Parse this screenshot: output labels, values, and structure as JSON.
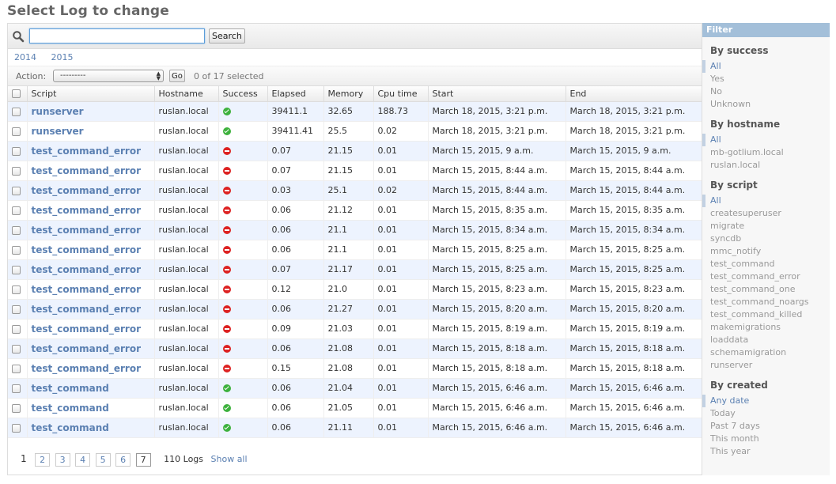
{
  "page": {
    "title": "Select Log to change"
  },
  "search": {
    "value": "",
    "button_label": "Search"
  },
  "date_hierarchy": [
    "2014",
    "2015"
  ],
  "actions": {
    "label": "Action:",
    "selected": "---------",
    "go_label": "Go",
    "selection_count": "0 of 17 selected"
  },
  "table": {
    "headers": [
      "Script",
      "Hostname",
      "Success",
      "Elapsed",
      "Memory",
      "Cpu time",
      "Start",
      "End"
    ],
    "rows": [
      {
        "script": "runserver",
        "hostname": "ruslan.local",
        "success": "ok",
        "elapsed": "39411.1",
        "memory": "32.65",
        "cpu": "188.73",
        "start": "March 18, 2015, 3:21 p.m.",
        "end": "March 18, 2015, 3:21 p.m."
      },
      {
        "script": "runserver",
        "hostname": "ruslan.local",
        "success": "ok",
        "elapsed": "39411.41",
        "memory": "25.5",
        "cpu": "0.02",
        "start": "March 18, 2015, 3:21 p.m.",
        "end": "March 18, 2015, 3:21 p.m."
      },
      {
        "script": "test_command_error",
        "hostname": "ruslan.local",
        "success": "err",
        "elapsed": "0.07",
        "memory": "21.15",
        "cpu": "0.01",
        "start": "March 15, 2015, 9 a.m.",
        "end": "March 15, 2015, 9 a.m."
      },
      {
        "script": "test_command_error",
        "hostname": "ruslan.local",
        "success": "err",
        "elapsed": "0.07",
        "memory": "21.15",
        "cpu": "0.01",
        "start": "March 15, 2015, 8:44 a.m.",
        "end": "March 15, 2015, 8:44 a.m."
      },
      {
        "script": "test_command_error",
        "hostname": "ruslan.local",
        "success": "err",
        "elapsed": "0.03",
        "memory": "25.1",
        "cpu": "0.02",
        "start": "March 15, 2015, 8:44 a.m.",
        "end": "March 15, 2015, 8:44 a.m."
      },
      {
        "script": "test_command_error",
        "hostname": "ruslan.local",
        "success": "err",
        "elapsed": "0.06",
        "memory": "21.12",
        "cpu": "0.01",
        "start": "March 15, 2015, 8:35 a.m.",
        "end": "March 15, 2015, 8:35 a.m."
      },
      {
        "script": "test_command_error",
        "hostname": "ruslan.local",
        "success": "err",
        "elapsed": "0.06",
        "memory": "21.1",
        "cpu": "0.01",
        "start": "March 15, 2015, 8:34 a.m.",
        "end": "March 15, 2015, 8:34 a.m."
      },
      {
        "script": "test_command_error",
        "hostname": "ruslan.local",
        "success": "err",
        "elapsed": "0.06",
        "memory": "21.1",
        "cpu": "0.01",
        "start": "March 15, 2015, 8:25 a.m.",
        "end": "March 15, 2015, 8:25 a.m."
      },
      {
        "script": "test_command_error",
        "hostname": "ruslan.local",
        "success": "err",
        "elapsed": "0.07",
        "memory": "21.17",
        "cpu": "0.01",
        "start": "March 15, 2015, 8:25 a.m.",
        "end": "March 15, 2015, 8:25 a.m."
      },
      {
        "script": "test_command_error",
        "hostname": "ruslan.local",
        "success": "err",
        "elapsed": "0.12",
        "memory": "21.0",
        "cpu": "0.01",
        "start": "March 15, 2015, 8:23 a.m.",
        "end": "March 15, 2015, 8:23 a.m."
      },
      {
        "script": "test_command_error",
        "hostname": "ruslan.local",
        "success": "err",
        "elapsed": "0.06",
        "memory": "21.27",
        "cpu": "0.01",
        "start": "March 15, 2015, 8:20 a.m.",
        "end": "March 15, 2015, 8:20 a.m."
      },
      {
        "script": "test_command_error",
        "hostname": "ruslan.local",
        "success": "err",
        "elapsed": "0.09",
        "memory": "21.03",
        "cpu": "0.01",
        "start": "March 15, 2015, 8:19 a.m.",
        "end": "March 15, 2015, 8:19 a.m."
      },
      {
        "script": "test_command_error",
        "hostname": "ruslan.local",
        "success": "err",
        "elapsed": "0.06",
        "memory": "21.08",
        "cpu": "0.01",
        "start": "March 15, 2015, 8:18 a.m.",
        "end": "March 15, 2015, 8:18 a.m."
      },
      {
        "script": "test_command_error",
        "hostname": "ruslan.local",
        "success": "err",
        "elapsed": "0.15",
        "memory": "21.08",
        "cpu": "0.01",
        "start": "March 15, 2015, 8:18 a.m.",
        "end": "March 15, 2015, 8:18 a.m."
      },
      {
        "script": "test_command",
        "hostname": "ruslan.local",
        "success": "ok",
        "elapsed": "0.06",
        "memory": "21.04",
        "cpu": "0.01",
        "start": "March 15, 2015, 6:46 a.m.",
        "end": "March 15, 2015, 6:46 a.m."
      },
      {
        "script": "test_command",
        "hostname": "ruslan.local",
        "success": "ok",
        "elapsed": "0.06",
        "memory": "21.05",
        "cpu": "0.01",
        "start": "March 15, 2015, 6:46 a.m.",
        "end": "March 15, 2015, 6:46 a.m."
      },
      {
        "script": "test_command",
        "hostname": "ruslan.local",
        "success": "ok",
        "elapsed": "0.06",
        "memory": "21.11",
        "cpu": "0.01",
        "start": "March 15, 2015, 6:46 a.m.",
        "end": "March 15, 2015, 6:46 a.m."
      }
    ]
  },
  "paginator": {
    "current": "1",
    "pages": [
      "2",
      "3",
      "4",
      "5",
      "6"
    ],
    "last": "7",
    "count": "110 Logs",
    "show_all": "Show all"
  },
  "filter": {
    "title": "Filter",
    "sections": [
      {
        "heading": "By success",
        "items": [
          "All",
          "Yes",
          "No",
          "Unknown"
        ]
      },
      {
        "heading": "By hostname",
        "items": [
          "All",
          "mb-gotlium.local",
          "ruslan.local"
        ]
      },
      {
        "heading": "By script",
        "items": [
          "All",
          "createsuperuser",
          "migrate",
          "syncdb",
          "mmc_notify",
          "test_command",
          "test_command_error",
          "test_command_one",
          "test_command_noargs",
          "test_command_killed",
          "makemigrations",
          "loaddata",
          "schemamigration",
          "runserver"
        ]
      },
      {
        "heading": "By created",
        "items": [
          "Any date",
          "Today",
          "Past 7 days",
          "This month",
          "This year"
        ]
      }
    ]
  }
}
